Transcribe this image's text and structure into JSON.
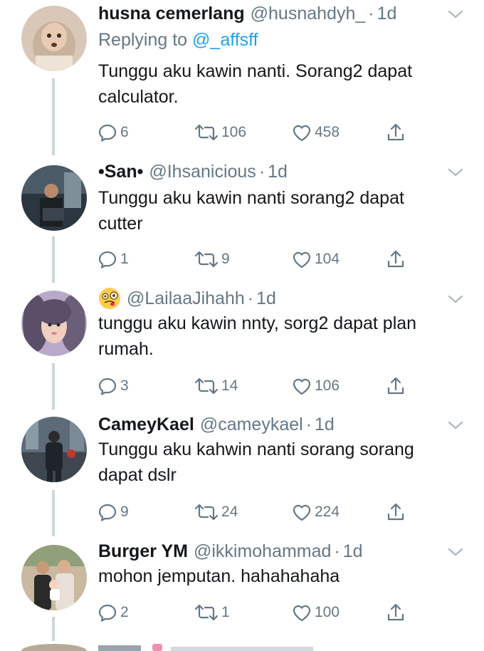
{
  "tweets": [
    {
      "name": "husna cemerlang",
      "handle": "@husnahdyh_",
      "dot": "·",
      "time": "1d",
      "reply_prefix": "Replying to ",
      "reply_mention": "@_affsff",
      "text": "Tunggu aku kawin nanti. Sorang2 dapat\ncalculator.",
      "replies": "6",
      "retweets": "106",
      "likes": "458"
    },
    {
      "name": "•San•",
      "handle": "@Ihsanicious",
      "dot": "·",
      "time": "1d",
      "text": "Tunggu aku kawin nanti sorang2 dapat\ncutter",
      "replies": "1",
      "retweets": "9",
      "likes": "104"
    },
    {
      "name": "",
      "emoji": "dizzy-face-emoji",
      "handle": "@LailaaJihahh",
      "dot": "·",
      "time": "1d",
      "text": "tunggu aku kawin nnty, sorg2 dapat plan\nrumah.",
      "replies": "3",
      "retweets": "14",
      "likes": "106"
    },
    {
      "name": "CameyKael",
      "handle": "@cameykael",
      "dot": "·",
      "time": "1d",
      "text": "Tunggu aku kahwin nanti sorang sorang\ndapat dslr",
      "replies": "9",
      "retweets": "24",
      "likes": "224"
    },
    {
      "name": "Burger YM",
      "handle": "@ikkimohammad",
      "dot": "·",
      "time": "1d",
      "text": "mohon jemputan. hahahahaha",
      "replies": "2",
      "retweets": "1",
      "likes": "100"
    }
  ],
  "colors": {
    "text": "#14171a",
    "muted": "#657786",
    "link": "#1da1f2",
    "thread_line": "#ccd6dd"
  },
  "icons": [
    "reply-icon",
    "retweet-icon",
    "like-icon",
    "share-icon",
    "chevron-down-icon"
  ]
}
